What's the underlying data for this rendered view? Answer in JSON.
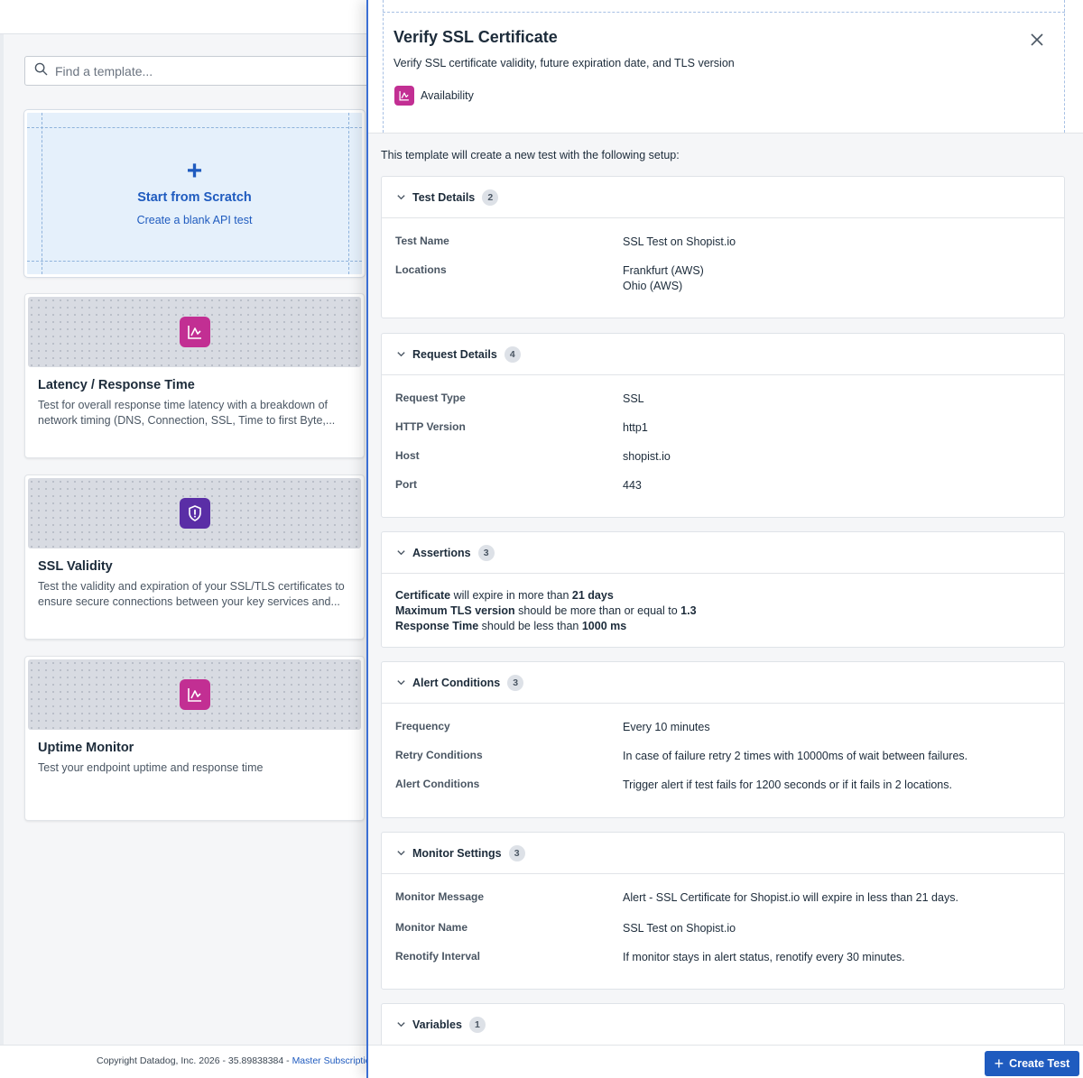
{
  "search": {
    "placeholder": "Find a template..."
  },
  "scratch": {
    "plus": "+",
    "title": "Start from Scratch",
    "subtitle": "Create a blank API test"
  },
  "templates": [
    {
      "title": "Latency / Response Time",
      "description": "Test for overall response time latency with a breakdown of network timing (DNS, Connection, SSL, Time to first Byte,...",
      "icon": "chart-icon",
      "color": "#c22f93"
    },
    {
      "title": "SSL Validity",
      "description": "Test the validity and expiration of your SSL/TLS certificates to ensure secure connections between your key services and...",
      "icon": "shield-icon",
      "color": "#5a2ea6"
    },
    {
      "title": "Uptime Monitor",
      "description": "Test your endpoint uptime and response time",
      "icon": "chart-icon",
      "color": "#c22f93"
    }
  ],
  "footer": {
    "text": "Copyright Datadog, Inc. 2026 - 35.89838384 - ",
    "link": "Master Subscription"
  },
  "panel": {
    "title": "Verify SSL Certificate",
    "description": "Verify SSL certificate validity, future expiration date, and TLS version",
    "tag": "Availability",
    "intro": "This template will create a new test with the following setup:",
    "create_label": "Create Test"
  },
  "sections": {
    "test_details": {
      "title": "Test Details",
      "count": "2",
      "rows": [
        {
          "key": "Test Name",
          "value": "SSL Test on Shopist.io"
        },
        {
          "key": "Locations",
          "value1": "Frankfurt (AWS)",
          "value2": "Ohio (AWS)"
        }
      ]
    },
    "request_details": {
      "title": "Request Details",
      "count": "4",
      "rows": [
        {
          "key": "Request Type",
          "value": "SSL"
        },
        {
          "key": "HTTP Version",
          "value": "http1"
        },
        {
          "key": "Host",
          "value": "shopist.io"
        },
        {
          "key": "Port",
          "value": "443"
        }
      ]
    },
    "assertions": {
      "title": "Assertions",
      "count": "3",
      "items": [
        {
          "subject": "Certificate",
          "op": " will expire in more than ",
          "target": "21 days"
        },
        {
          "subject": "Maximum TLS version",
          "op": " should be more than or equal to ",
          "target": "1.3"
        },
        {
          "subject": "Response Time",
          "op": " should be less than ",
          "target": "1000 ms"
        }
      ]
    },
    "alert_conditions": {
      "title": "Alert Conditions",
      "count": "3",
      "rows": [
        {
          "key": "Frequency",
          "value": "Every 10 minutes"
        },
        {
          "key": "Retry Conditions",
          "value": "In case of failure retry 2 times with 10000ms of wait between failures."
        },
        {
          "key": "Alert Conditions",
          "value": "Trigger alert if test fails for 1200 seconds or if it fails in 2 locations."
        }
      ]
    },
    "monitor_settings": {
      "title": "Monitor Settings",
      "count": "3",
      "rows": [
        {
          "key": "Monitor Message",
          "value": "Alert - SSL Certificate for Shopist.io will expire in less than 21 days."
        },
        {
          "key": "Monitor Name",
          "value": "SSL Test on Shopist.io"
        },
        {
          "key": "Renotify Interval",
          "value": "If monitor stays in alert status, renotify every 30 minutes."
        }
      ]
    },
    "variables": {
      "title": "Variables",
      "count": "1"
    }
  },
  "colors": {
    "accent": "#1f5bbf",
    "availability": "#c22f93",
    "security": "#5a2ea6"
  }
}
